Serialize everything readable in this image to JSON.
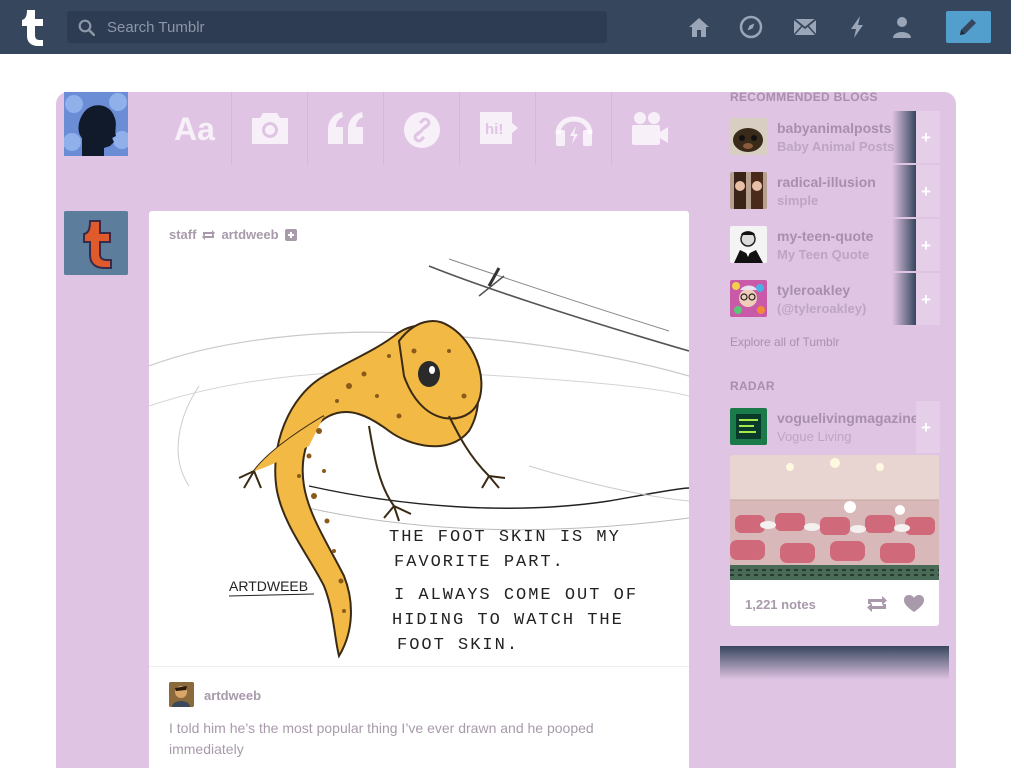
{
  "search": {
    "placeholder": "Search Tumblr"
  },
  "nav": {
    "items": [
      {
        "name": "home-icon"
      },
      {
        "name": "explore-compass-icon"
      },
      {
        "name": "inbox-mail-icon"
      },
      {
        "name": "activity-lightning-icon"
      },
      {
        "name": "account-person-icon"
      }
    ],
    "compose_icon": "pencil-icon"
  },
  "post_types": [
    {
      "name": "text",
      "icon": "text-aa-icon",
      "glyph": "Aa"
    },
    {
      "name": "photo",
      "icon": "camera-icon"
    },
    {
      "name": "quote",
      "icon": "quote-icon"
    },
    {
      "name": "link",
      "icon": "link-icon"
    },
    {
      "name": "chat",
      "icon": "chat-hi-icon",
      "glyph": "hi!"
    },
    {
      "name": "audio",
      "icon": "headphones-icon"
    },
    {
      "name": "video",
      "icon": "video-camera-icon"
    }
  ],
  "post": {
    "blog": "staff",
    "reblogged_from": "artdweeb",
    "image_text": {
      "line1": "THE FOOT SKIN IS MY",
      "line2": "FAVORITE PART.",
      "line3": "I ALWAYS COME OUT OF",
      "line4": "HIDING TO WATCH THE",
      "line5": "FOOT SKIN.",
      "signature": "ARTDWEEB"
    },
    "caption_author": "artdweeb",
    "caption": "I told him he’s the most popular thing I’ve ever drawn and he pooped immediately"
  },
  "sidebar": {
    "recommended_heading": "RECOMMENDED BLOGS",
    "recommended": [
      {
        "name": "babyanimalposts",
        "title": "Baby Animal Posts"
      },
      {
        "name": "radical-illusion",
        "title": "simple"
      },
      {
        "name": "my-teen-quote",
        "title": "My Teen Quote"
      },
      {
        "name": "tyleroakley",
        "title": "(@tyleroakley)"
      }
    ],
    "follow_label": "+",
    "explore_link": "Explore all of Tumblr",
    "radar_heading": "RADAR",
    "radar": {
      "name": "voguelivingmagazine",
      "title": "Vogue Living",
      "notes": "1,221 notes"
    }
  },
  "colors": {
    "navbar": "#36465d",
    "panel": "#e0c4e4",
    "accent": "#529ecc",
    "muted_text": "#a89aab"
  }
}
